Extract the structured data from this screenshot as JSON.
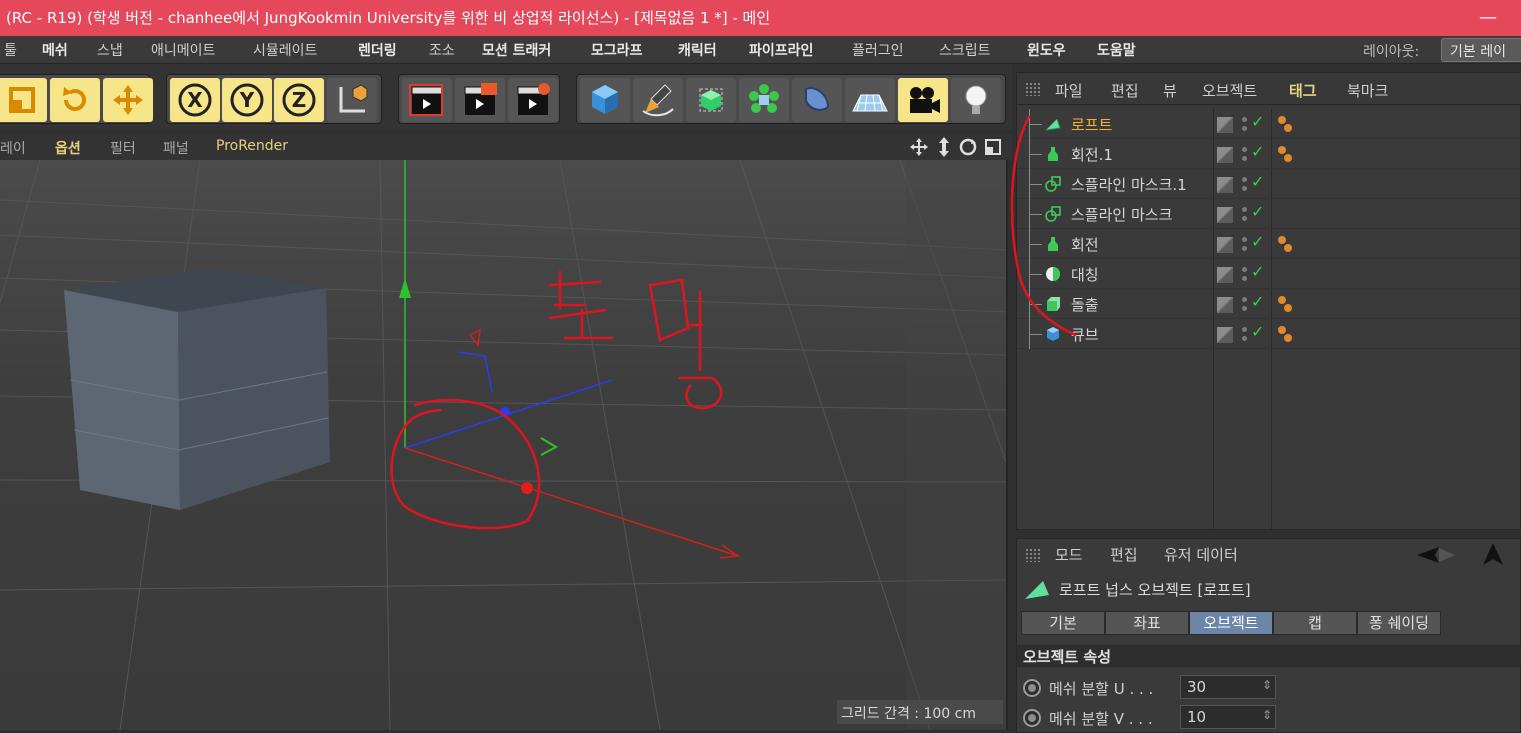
{
  "window": {
    "title": "(RC - R19) (학생 버전 - chanhee에서 JungKookmin University를 위한 비 상업적 라이선스) - [제목없음 1 *] - 메인",
    "minimize": "—"
  },
  "menubar": {
    "items": [
      "툴",
      "메쉬",
      "스냅",
      "애니메이트",
      "시뮬레이트",
      "렌더링",
      "조소",
      "모션 트래커",
      "모그라프",
      "캐릭터",
      "파이프라인",
      "플러그인",
      "스크립트",
      "윈도우",
      "도움말"
    ],
    "layout_label": "레이아웃:",
    "layout_value": "기본 레이"
  },
  "toolbar": {
    "icons": [
      "scale-icon",
      "rotate-icon",
      "move-icon",
      "x-axis-icon",
      "y-axis-icon",
      "z-axis-icon",
      "coordinate-system-icon",
      "render-view-icon",
      "render-picture-viewer-icon",
      "render-settings-icon",
      "cube-icon",
      "pen-icon",
      "subdivision-icon",
      "array-icon",
      "deformer-icon",
      "floor-icon",
      "camera-icon",
      "light-icon"
    ],
    "axis_x": "X",
    "axis_y": "Y",
    "axis_z": "Z"
  },
  "viewport_menu": {
    "items": [
      "레이",
      "옵션",
      "필터",
      "패널",
      "ProRender"
    ],
    "grid_info": "그리드 간격 : 100 cm",
    "annotation_text": "투명"
  },
  "object_manager": {
    "header": [
      "파일",
      "편집",
      "뷰",
      "오브젝트",
      "태그",
      "북마크"
    ],
    "objects": [
      {
        "name": "로프트",
        "icon": "loft-icon",
        "selected": true,
        "tag": true
      },
      {
        "name": "회전.1",
        "icon": "lathe-icon",
        "selected": false,
        "tag": true
      },
      {
        "name": "스플라인 마스크.1",
        "icon": "spline-mask-icon",
        "selected": false,
        "tag": false
      },
      {
        "name": "스플라인 마스크",
        "icon": "spline-mask-icon",
        "selected": false,
        "tag": false
      },
      {
        "name": "회전",
        "icon": "lathe-icon",
        "selected": false,
        "tag": true
      },
      {
        "name": "대칭",
        "icon": "symmetry-icon",
        "selected": false,
        "tag": false
      },
      {
        "name": "돌출",
        "icon": "extrude-icon",
        "selected": false,
        "tag": true
      },
      {
        "name": "큐브",
        "icon": "cube-icon",
        "selected": false,
        "tag": true
      }
    ],
    "check": "✓"
  },
  "attributes": {
    "header": [
      "모드",
      "편집",
      "유저 데이터"
    ],
    "title": "로프트 넙스 오브젝트 [로프트]",
    "tabs": [
      "기본",
      "좌표",
      "오브젝트",
      "캡",
      "퐁 쉐이딩"
    ],
    "active_tab": "오브젝트",
    "section": "오브젝트 속성",
    "fields": [
      {
        "label": "메쉬 분할 U . . .",
        "value": "30"
      },
      {
        "label": "메쉬 분할 V . . .",
        "value": "10"
      }
    ]
  },
  "colors": {
    "titlebar": "#e5485a",
    "accent_yellow": "#f7e58a",
    "selected_object": "#f2b23a",
    "annotation_red": "#e0141e",
    "active_tab": "#6d86a8"
  }
}
